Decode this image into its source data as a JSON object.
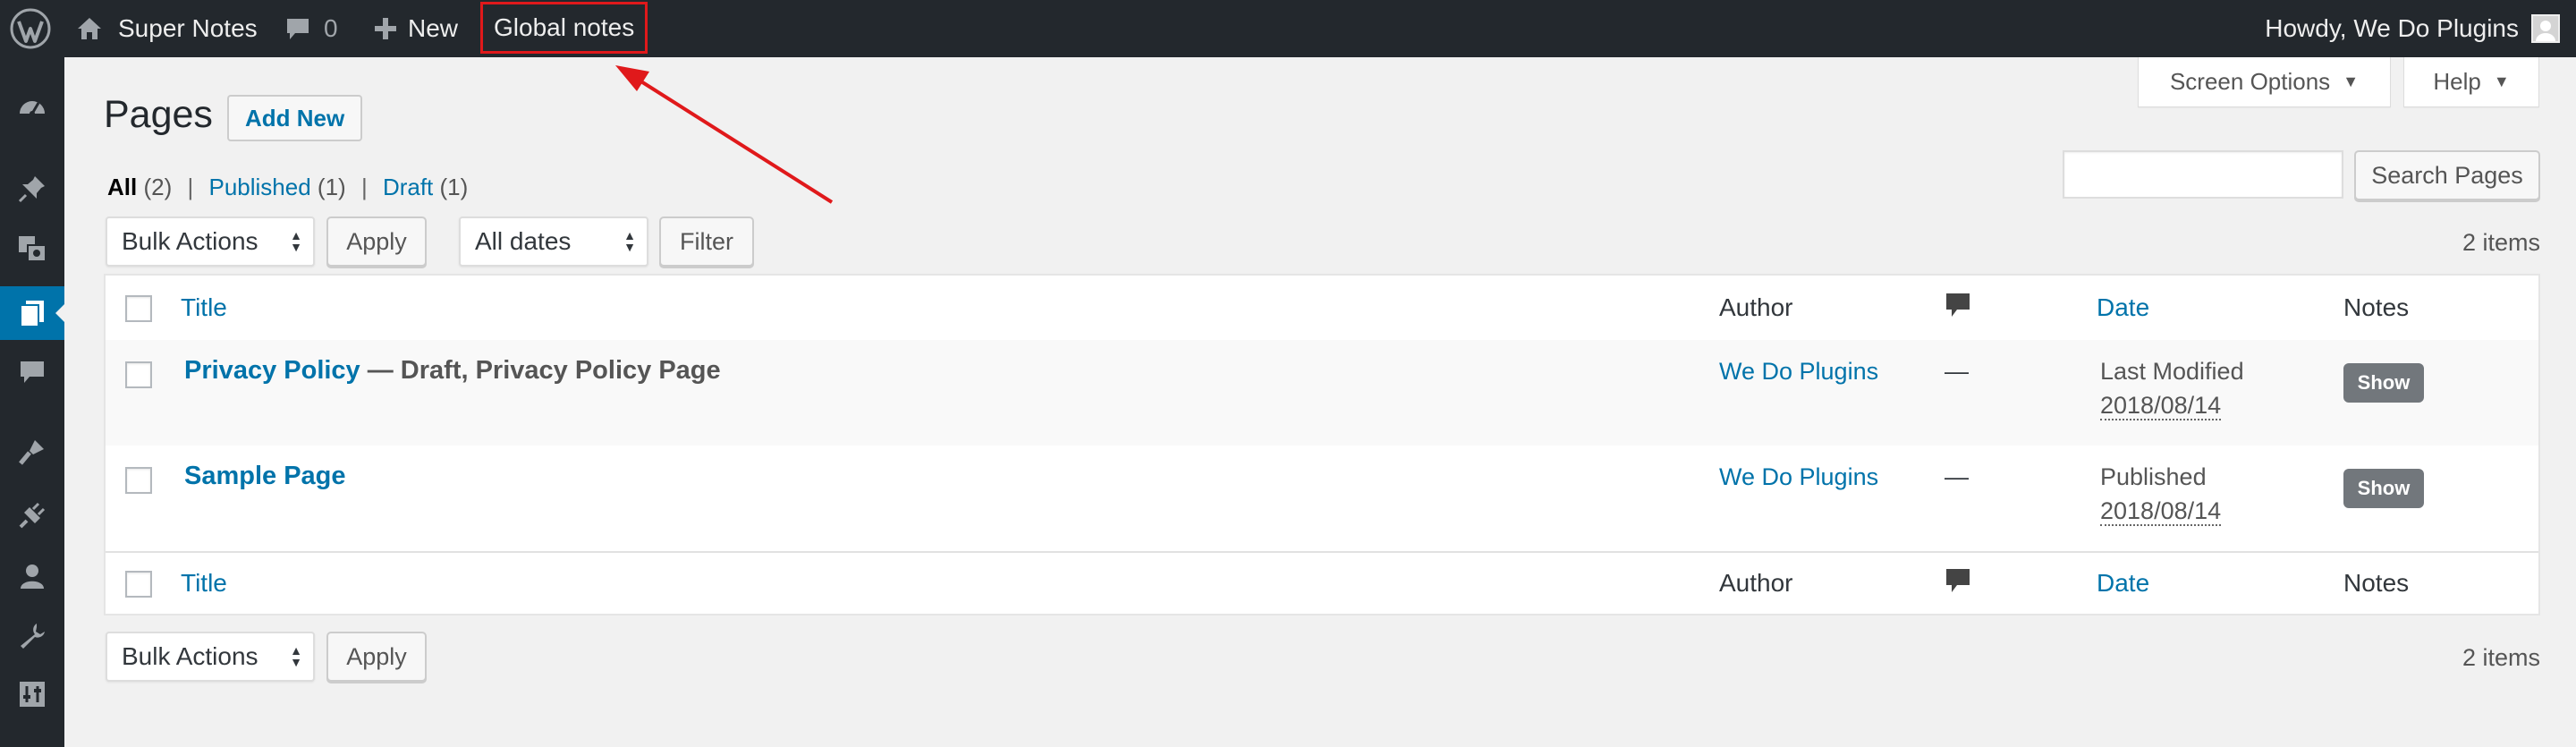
{
  "adminbar": {
    "site_name": "Super Notes",
    "comments_count": "0",
    "new_label": "New",
    "global_notes_label": "Global notes",
    "greeting": "Howdy, We Do Plugins"
  },
  "sidebar": {
    "items": [
      {
        "icon": "dashboard-icon"
      },
      {
        "icon": "pin-icon"
      },
      {
        "icon": "media-icon"
      },
      {
        "icon": "pages-icon",
        "current": true
      },
      {
        "icon": "comments-icon"
      },
      {
        "icon": "appearance-icon"
      },
      {
        "icon": "plugins-icon"
      },
      {
        "icon": "users-icon"
      },
      {
        "icon": "tools-icon"
      },
      {
        "icon": "settings-icon"
      }
    ]
  },
  "screen_meta": {
    "screen_options_label": "Screen Options",
    "help_label": "Help"
  },
  "page": {
    "title": "Pages",
    "add_new_label": "Add New"
  },
  "views": {
    "all_label": "All",
    "all_count": "(2)",
    "published_label": "Published",
    "published_count": "(1)",
    "draft_label": "Draft",
    "draft_count": "(1)",
    "separator": "|"
  },
  "search": {
    "value": "",
    "button_label": "Search Pages"
  },
  "tablenav": {
    "bulk_actions": "Bulk Actions",
    "apply_label": "Apply",
    "dates_selected": "All dates",
    "filter_label": "Filter",
    "items_count": "2 items"
  },
  "table": {
    "columns": {
      "title": "Title",
      "author": "Author",
      "date": "Date",
      "notes": "Notes"
    },
    "rows": [
      {
        "title": "Privacy Policy",
        "state": " — Draft, Privacy Policy Page",
        "author": "We Do Plugins",
        "comments": "—",
        "date_status": "Last Modified",
        "date": "2018/08/14",
        "notes_button": "Show"
      },
      {
        "title": "Sample Page",
        "state": "",
        "author": "We Do Plugins",
        "comments": "—",
        "date_status": "Published",
        "date": "2018/08/14",
        "notes_button": "Show"
      }
    ]
  },
  "colors": {
    "adminbar_bg": "#23282d",
    "link": "#0073aa",
    "highlight_box": "#e0191b",
    "arrow": "#e0191b"
  }
}
